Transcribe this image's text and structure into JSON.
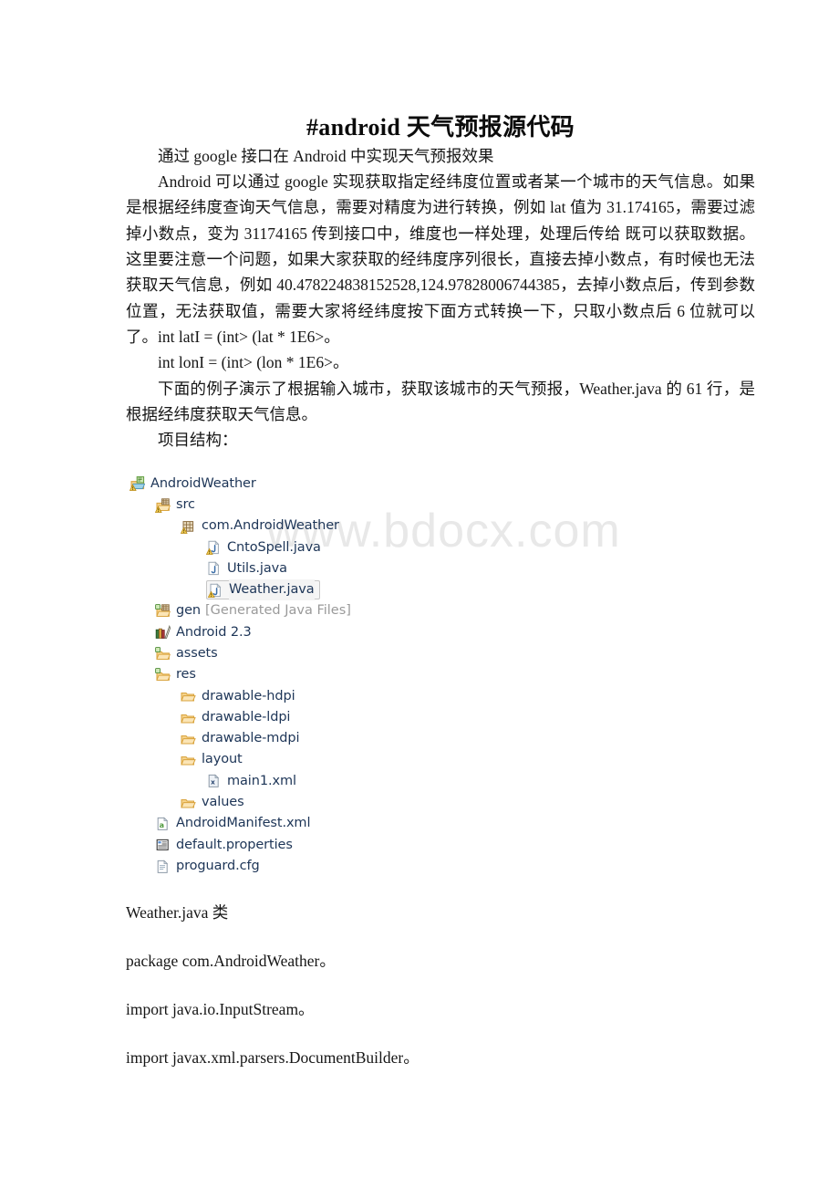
{
  "document": {
    "title": "#android 天气预报源代码",
    "watermark": "www.bdocx.com",
    "subtitle": "通过 google 接口在 Android 中实现天气预报效果",
    "paragraphs": [
      "Android 可以通过 google 实现获取指定经纬度位置或者某一个城市的天气信息。如果是根据经纬度查询天气信息，需要对精度为进行转换，例如 lat 值为 31.174165，需要过滤掉小数点，变为 31174165 传到接口中，维度也一样处理，处理后传给 既可以获取数据。这里要注意一个问题，如果大家获取的经纬度序列很长，直接去掉小数点，有时候也无法获取天气信息，例如 40.478224838152528,124.97828006744385，去掉小数点后，传到参数位置，无法获取值，需要大家将经纬度按下面方式转换一下，只取小数点后 6 位就可以了。int latI = (int> (lat * 1E6>。",
      "int lonI = (int> (lon * 1E6>。",
      "下面的例子演示了根据输入城市，获取该城市的天气预报，Weather.java 的 61 行，是根据经纬度获取天气信息。",
      "项目结构："
    ],
    "trailing": [
      "Weather.java 类",
      "package com.AndroidWeather。",
      "import java.io.InputStream。",
      "import javax.xml.parsers.DocumentBuilder。"
    ]
  },
  "project_tree": {
    "nodes": [
      {
        "label": "AndroidWeather",
        "icon": "android-project-icon",
        "level": 0,
        "selected": false,
        "note": ""
      },
      {
        "label": "src",
        "icon": "source-folder-icon",
        "level": 1,
        "selected": false,
        "note": ""
      },
      {
        "label": "com.AndroidWeather",
        "icon": "package-icon",
        "level": 2,
        "selected": false,
        "note": ""
      },
      {
        "label": "CntoSpell.java",
        "icon": "java-file-warning-icon",
        "level": 3,
        "selected": false,
        "note": ""
      },
      {
        "label": "Utils.java",
        "icon": "java-file-icon",
        "level": 3,
        "selected": false,
        "note": ""
      },
      {
        "label": "Weather.java",
        "icon": "java-file-warning-icon",
        "level": 3,
        "selected": true,
        "note": ""
      },
      {
        "label": "gen",
        "icon": "generated-source-folder-icon",
        "level": 1,
        "selected": false,
        "note": "[Generated Java Files]"
      },
      {
        "label": "Android 2.3",
        "icon": "library-icon",
        "level": 1,
        "selected": false,
        "note": ""
      },
      {
        "label": "assets",
        "icon": "assets-folder-icon",
        "level": 1,
        "selected": false,
        "note": ""
      },
      {
        "label": "res",
        "icon": "assets-folder-icon",
        "level": 1,
        "selected": false,
        "note": ""
      },
      {
        "label": "drawable-hdpi",
        "icon": "folder-icon",
        "level": 2,
        "selected": false,
        "note": ""
      },
      {
        "label": "drawable-ldpi",
        "icon": "folder-icon",
        "level": 2,
        "selected": false,
        "note": ""
      },
      {
        "label": "drawable-mdpi",
        "icon": "folder-icon",
        "level": 2,
        "selected": false,
        "note": ""
      },
      {
        "label": "layout",
        "icon": "folder-icon",
        "level": 2,
        "selected": false,
        "note": ""
      },
      {
        "label": "main1.xml",
        "icon": "xml-file-icon",
        "level": 3,
        "selected": false,
        "note": ""
      },
      {
        "label": "values",
        "icon": "folder-icon",
        "level": 2,
        "selected": false,
        "note": ""
      },
      {
        "label": "AndroidManifest.xml",
        "icon": "android-manifest-icon",
        "level": 1,
        "selected": false,
        "note": ""
      },
      {
        "label": "default.properties",
        "icon": "properties-file-icon",
        "level": 1,
        "selected": false,
        "note": ""
      },
      {
        "label": "proguard.cfg",
        "icon": "text-file-icon",
        "level": 1,
        "selected": false,
        "note": ""
      }
    ]
  },
  "colors": {
    "tree_text": "#1d3557",
    "tree_note": "#9a9a9a",
    "watermark": "#e8e8e8",
    "folder_fill": "#f5d28a",
    "folder_stroke": "#d9a33c",
    "page_background": "#ffffff",
    "body_text": "#161616"
  }
}
